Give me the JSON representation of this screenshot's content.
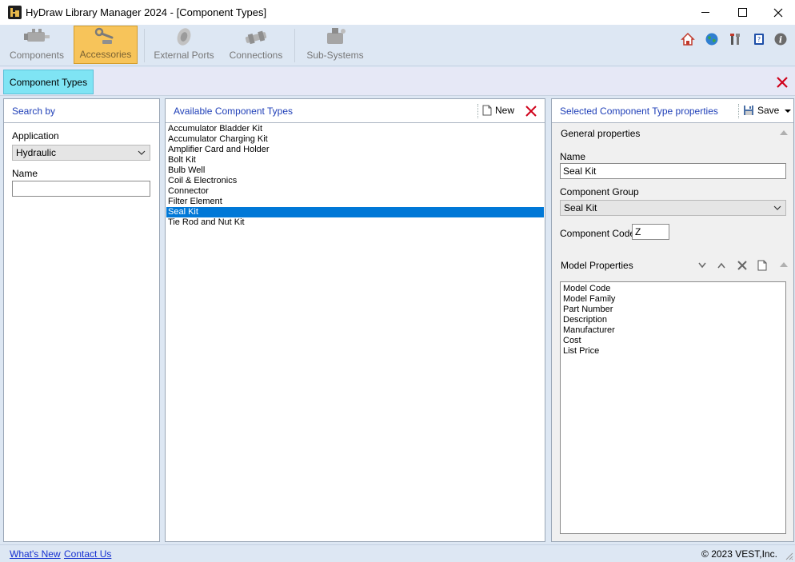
{
  "window": {
    "title": "HyDraw Library Manager 2024 - [Component Types]"
  },
  "ribbon": {
    "buttons": [
      {
        "label": "Components",
        "icon": "cylinder-icon"
      },
      {
        "label": "Accessories",
        "icon": "wrench-icon",
        "selected": true
      },
      {
        "label": "External Ports",
        "icon": "port-icon"
      },
      {
        "label": "Connections",
        "icon": "fitting-icon"
      },
      {
        "label": "Sub-Systems",
        "icon": "pump-icon"
      }
    ],
    "right_icons": [
      "home-icon",
      "globe-icon",
      "tools-icon",
      "help-book-icon",
      "info-icon"
    ]
  },
  "tabs": {
    "active_label": "Component Types"
  },
  "search_panel": {
    "header": "Search by",
    "application_label": "Application",
    "application_value": "Hydraulic",
    "name_label": "Name",
    "name_value": ""
  },
  "available_panel": {
    "header": "Available Component Types",
    "new_label": "New",
    "items": [
      "Accumulator Bladder Kit",
      "Accumulator Charging Kit",
      "Amplifier Card and Holder",
      "Bolt Kit",
      "Bulb Well",
      "Coil & Electronics",
      "Connector",
      "Filter Element",
      "Seal Kit",
      "Tie Rod and Nut Kit"
    ],
    "selected_item": "Seal Kit"
  },
  "props_panel": {
    "header": "Selected Component Type properties",
    "save_label": "Save",
    "general_label": "General properties",
    "name_label": "Name",
    "name_value": "Seal Kit",
    "group_label": "Component Group",
    "group_value": "Seal Kit",
    "code_label": "Component Code",
    "code_value": "Z",
    "model_label": "Model Properties",
    "model_items": [
      "Model Code",
      "Model Family",
      "Part Number",
      "Description",
      "Manufacturer",
      "Cost",
      "List Price"
    ]
  },
  "status": {
    "whats_new": "What's New",
    "contact_us": "Contact Us",
    "copyright": "2023 VEST,Inc."
  },
  "colors": {
    "accent_selected": "#0078d7",
    "ribbon_active": "#f7c45a",
    "tab_active": "#7fe4f4",
    "delete_red": "#d0021b",
    "header_blue": "#2040b8"
  }
}
